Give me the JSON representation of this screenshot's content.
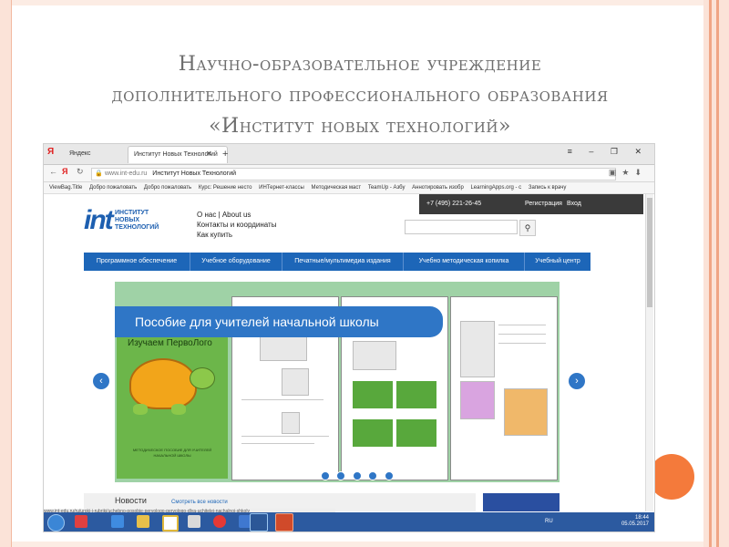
{
  "slide": {
    "title_lines": [
      "Научно-образовательное учреждение",
      "дополнительного профессионального образования",
      "«Институт новых технологий»"
    ],
    "colors": {
      "frame": "#fbe3d8",
      "accent_dot": "#f47a3b",
      "title": "#6e6e6e"
    }
  },
  "browser": {
    "tabs": [
      {
        "label": "Яндекс"
      },
      {
        "label": "Институт Новых Технологий",
        "active": true
      }
    ],
    "new_tab": "+",
    "url_host": "www.int-edu.ru",
    "url_page_title": "Институт Новых Технологий",
    "bookmarks": [
      "ViewBag.Title",
      "Добро пожаловать",
      "Добро пожаловать",
      "Курс: Решение несто",
      "ИНТернет-классы",
      "Методическая маст",
      "TeamUp - Азбу",
      "Аннотировать изобр",
      "LearningApps.org - с",
      "Запись к врачу"
    ]
  },
  "site": {
    "phone": "+7 (495) 221-26-45",
    "register": "Регистрация",
    "login": "Вход",
    "logo_mark": "int",
    "logo_text": "ИНСТИТУТ\nНОВЫХ\nТЕХНОЛОГИЙ",
    "top_links": {
      "about": "О нас | About us",
      "contacts": "Контакты и координаты",
      "how_to_buy": "Как купить"
    },
    "nav": [
      "Программное обеспечение",
      "Учебное оборудование",
      "Печатные/мультимедиа издания",
      "Учебно методическая копилка",
      "Учебный центр"
    ],
    "banner": "Пособие для учителей начальной школы",
    "cover_title": "Изучаем ПервоЛого",
    "cover_subtitle": "МЕТОДИЧЕСКОЕ ПОСОБИЕ ДЛЯ УЧИТЕЛЕЙ НАЧАЛЬНОЙ ШКОЛЫ",
    "carousel_dots": 5,
    "news_title": "Новости",
    "news_link": "Смотреть все новости"
  },
  "status": {
    "url": "www.int-edu.ru/ru/uroki-i-rubriki/uchebno-posobie-pervologo-pervologo-dlya-uchitelej-nachalnoj-shkoly",
    "lang": "RU",
    "time": "18:44",
    "date": "05.05.2017"
  }
}
